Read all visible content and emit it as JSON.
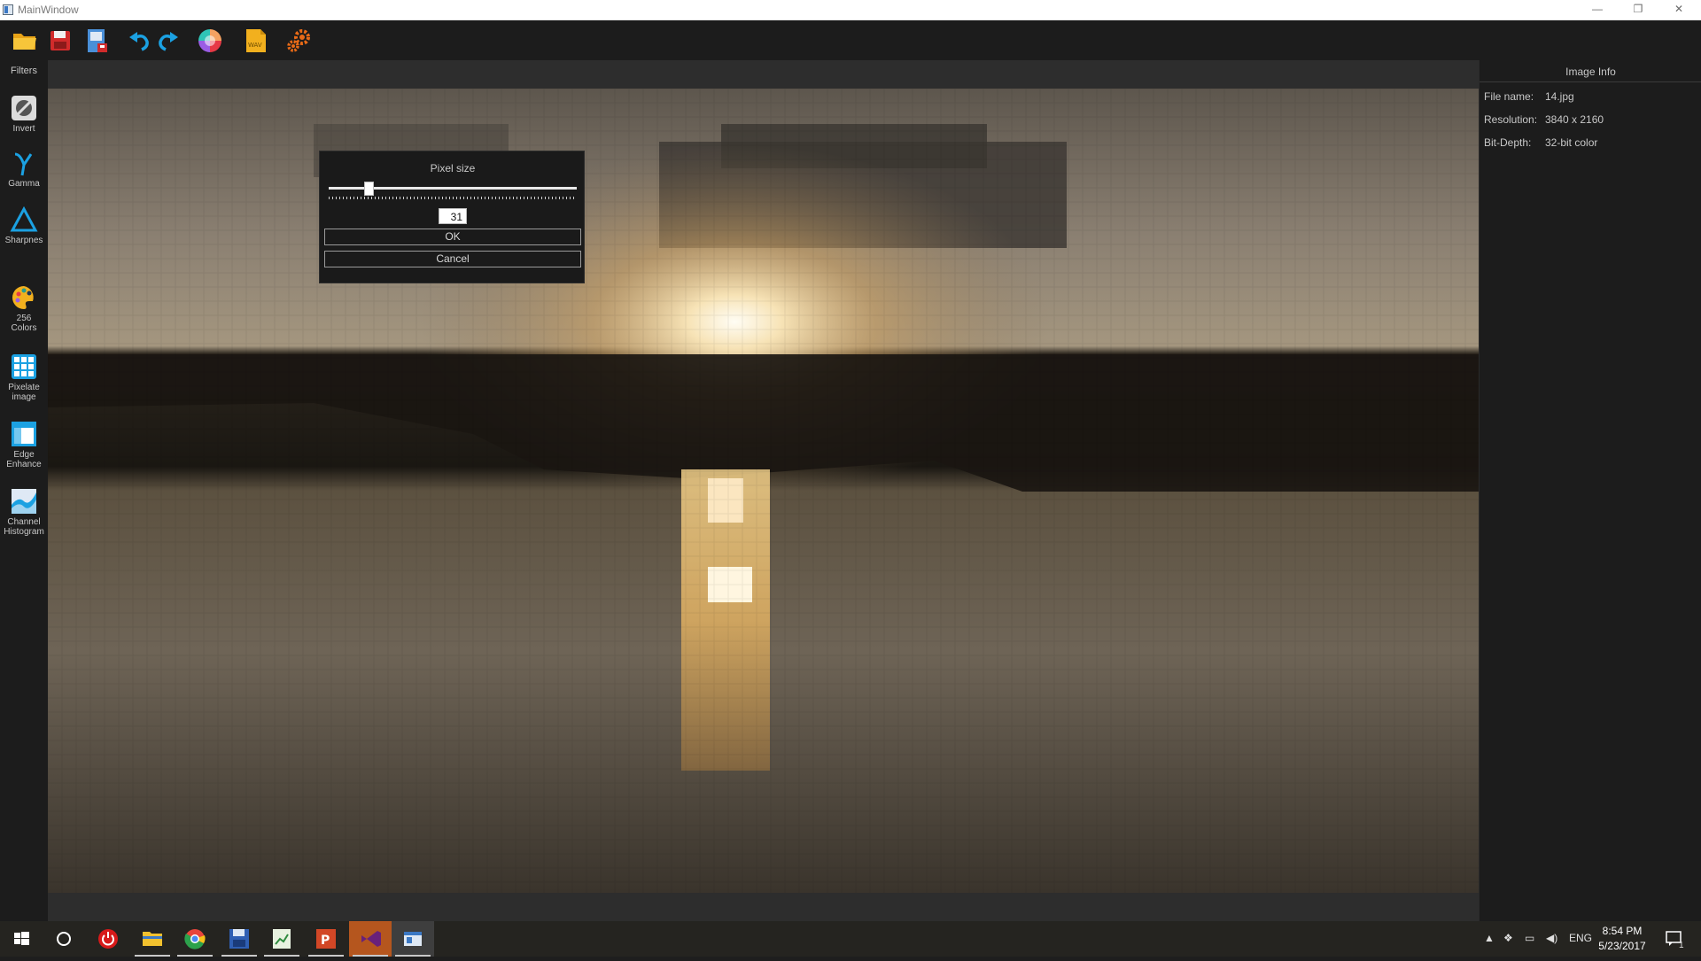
{
  "window": {
    "title": "MainWindow",
    "minimize_glyph": "—",
    "restore_glyph": "❐",
    "close_glyph": "✕"
  },
  "toolbar": {
    "buttons": [
      {
        "name": "open-folder-icon"
      },
      {
        "name": "save-icon"
      },
      {
        "name": "save-as-icon"
      },
      {
        "name": "undo-icon"
      },
      {
        "name": "redo-icon"
      },
      {
        "name": "color-wheel-icon"
      },
      {
        "name": "wav-file-icon",
        "text": "WAV"
      },
      {
        "name": "settings-gears-icon"
      }
    ]
  },
  "sidebar": {
    "header": "Filters",
    "items": [
      {
        "label": "Invert",
        "icon": "invert-icon"
      },
      {
        "label": "Gamma",
        "icon": "gamma-icon"
      },
      {
        "label": "Sharpnes",
        "icon": "sharpness-triangle-icon"
      },
      {
        "label": "256\nColors",
        "icon": "palette-icon"
      },
      {
        "label": "Pixelate\nimage",
        "icon": "pixelate-grid-icon"
      },
      {
        "label": "Edge\nEnhance",
        "icon": "edge-enhance-icon"
      },
      {
        "label": "Channel\nHistogram",
        "icon": "histogram-icon"
      }
    ]
  },
  "info_panel": {
    "header": "Image Info",
    "rows": [
      {
        "key": "File name:",
        "value": "14.jpg"
      },
      {
        "key": "Resolution:",
        "value": "3840 x 2160"
      },
      {
        "key": "Bit-Depth:",
        "value": "32-bit color"
      }
    ]
  },
  "dialog": {
    "title": "Pixel size",
    "value": "31",
    "slider_fraction": 0.15,
    "ok_label": "OK",
    "cancel_label": "Cancel"
  },
  "taskbar": {
    "apps": [
      "windows-start-icon",
      "cortana-icon",
      "power-icon",
      "file-explorer-icon",
      "chrome-icon",
      "floppy-app-icon",
      "sheet-app-icon",
      "powerpoint-icon",
      "visual-studio-icon",
      "mainwindow-app-icon"
    ],
    "language": "ENG",
    "time": "8:54 PM",
    "date": "5/23/2017",
    "notifications": "1"
  },
  "colors": {
    "accent": "#1ba1e2",
    "toolbar_bg": "#1c1c1c",
    "canvas_bg": "#2d2d2d"
  }
}
